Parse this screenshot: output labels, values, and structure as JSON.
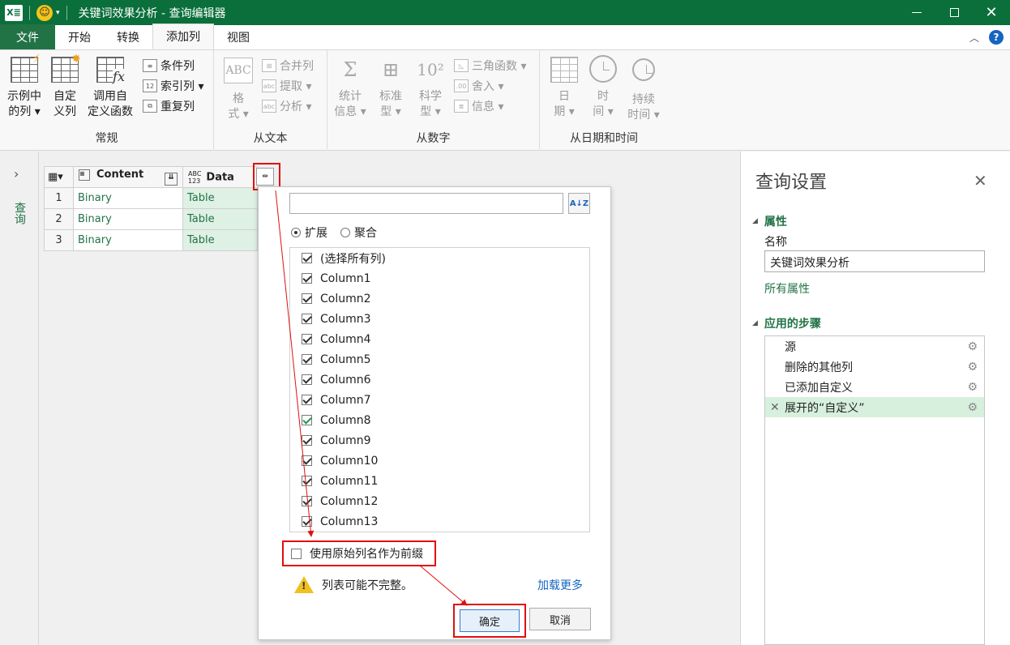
{
  "titlebar": {
    "logo": "X≣",
    "title": "关键词效果分析 - 查询编辑器",
    "minimize": "—",
    "close": "✕"
  },
  "tabs": {
    "file": "文件",
    "home": "开始",
    "transform": "转换",
    "add_column": "添加列",
    "view": "视图"
  },
  "ribbon": {
    "general": {
      "label": "常规",
      "example_col": [
        "示例中",
        "的列 ▾"
      ],
      "custom_col": [
        "自定",
        "义列"
      ],
      "invoke_fn": [
        "调用自",
        "定义函数"
      ],
      "conditional": "条件列",
      "index": "索引列 ▾",
      "duplicate": "重复列"
    },
    "from_text": {
      "label": "从文本",
      "format": [
        "格",
        "式 ▾"
      ],
      "merge": "合并列",
      "extract": "提取 ▾",
      "parse": "分析 ▾"
    },
    "from_number": {
      "label": "从数字",
      "stats": [
        "统计",
        "信息 ▾"
      ],
      "standard": [
        "标准",
        "型 ▾"
      ],
      "scientific": [
        "科学",
        "型 ▾"
      ],
      "trig": "三角函数 ▾",
      "rounding": "舍入 ▾",
      "info": "信息 ▾"
    },
    "from_date": {
      "label": "从日期和时间",
      "date": [
        "日",
        "期 ▾"
      ],
      "time": [
        "时",
        "间 ▾"
      ],
      "duration": [
        "持续",
        "时间 ▾"
      ]
    }
  },
  "leftnav": {
    "label": "查询"
  },
  "grid": {
    "headers": [
      "Content",
      "Data"
    ],
    "data_type": [
      "ABC",
      "123"
    ],
    "rows": [
      {
        "n": "1",
        "content": "Binary",
        "data": "Table"
      },
      {
        "n": "2",
        "content": "Binary",
        "data": "Table"
      },
      {
        "n": "3",
        "content": "Binary",
        "data": "Table"
      }
    ]
  },
  "popup": {
    "search_placeholder": "",
    "sort_label": "A↓Z",
    "radio_expand": "扩展",
    "radio_aggregate": "聚合",
    "columns": [
      "(选择所有列)",
      "Column1",
      "Column2",
      "Column3",
      "Column4",
      "Column5",
      "Column6",
      "Column7",
      "Column8",
      "Column9",
      "Column10",
      "Column11",
      "Column12",
      "Column13"
    ],
    "prefix_label": "使用原始列名作为前缀",
    "warning": "列表可能不完整。",
    "load_more": "加载更多",
    "ok": "确定",
    "cancel": "取消"
  },
  "settings": {
    "title": "查询设置",
    "properties": "属性",
    "name_label": "名称",
    "name_value": "关键词效果分析",
    "all_properties": "所有属性",
    "applied_steps": "应用的步骤",
    "steps": [
      "源",
      "删除的其他列",
      "已添加自定义",
      "展开的“自定义”"
    ]
  },
  "colors": {
    "excel_green": "#217346",
    "annotation_red": "#e01010"
  }
}
